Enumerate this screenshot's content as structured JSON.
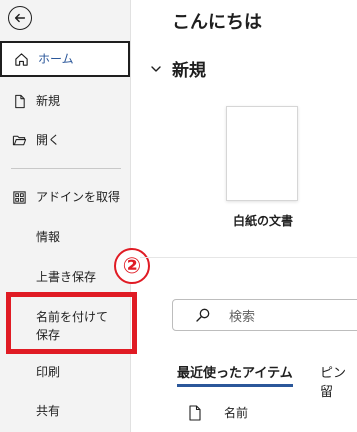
{
  "sidebar": {
    "items": [
      {
        "label": "ホーム",
        "icon": "home-icon"
      },
      {
        "label": "新規",
        "icon": "new-document-icon"
      },
      {
        "label": "開く",
        "icon": "folder-open-icon"
      },
      {
        "label": "アドインを取得",
        "icon": "grid-icon"
      },
      {
        "label": "情報"
      },
      {
        "label": "上書き保存"
      },
      {
        "label": "名前を付けて保存"
      },
      {
        "label": "印刷"
      },
      {
        "label": "共有"
      }
    ]
  },
  "annotation": {
    "badge_text": "②",
    "highlight_color": "#e01b24"
  },
  "main": {
    "greeting": "こんにちは",
    "new_section_title": "新規",
    "blank_doc_label": "白紙の文書",
    "search_placeholder": "検索",
    "tabs": [
      {
        "label": "最近使ったアイテム"
      },
      {
        "label": "ピン留"
      }
    ],
    "column_header": "名前"
  },
  "colors": {
    "accent": "#2b579a",
    "sidebar_bg": "#f3f3f3"
  }
}
